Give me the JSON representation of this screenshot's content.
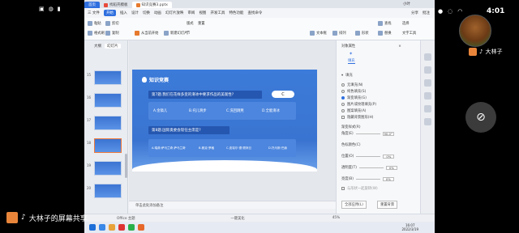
{
  "status_bar_left": {
    "icons": [
      "photo-icon",
      "wechat-icon",
      "signal-icon"
    ]
  },
  "status_bar_right": {
    "clock": "4:01"
  },
  "titlebar": {
    "tabs": [
      {
        "label": "首页",
        "kind": "home"
      },
      {
        "label": "找稻壳模板",
        "kind": "normal"
      },
      {
        "label": "知识竞赛3.pptx",
        "kind": "active"
      }
    ],
    "user": "小叶"
  },
  "menubar": {
    "items": [
      "三 文件",
      "开始",
      "插入",
      "设计",
      "切换",
      "动画",
      "幻灯片放映",
      "审阅",
      "视图",
      "开发工具",
      "特色功能",
      "查找命令"
    ],
    "right": [
      "分享",
      "批注"
    ]
  },
  "ribbon": {
    "labels": [
      "粘贴",
      "格式刷",
      "剪切",
      "复制",
      "从当前开始",
      "新建幻灯片",
      "版式",
      "节",
      "重置",
      "文本框",
      "排列",
      "形状",
      "查找",
      "替换",
      "文字工具",
      "选择"
    ]
  },
  "left_pane": {
    "tabs": [
      "大纲",
      "幻灯片"
    ],
    "slide_numbers": [
      "15",
      "16",
      "17",
      "18",
      "19",
      "20"
    ],
    "selected": "18"
  },
  "slide": {
    "title": "知识竞赛",
    "q7": "第7题.我们在花样多变的滑冰中要求作品的美观性?",
    "q7_answer": "C",
    "q7_options": [
      "A.金镐儿",
      "B.托儿滑步",
      "C.洗回跳凳",
      "D.全能滑冰"
    ],
    "q8": "第8题.国际奥委会现任主席是?",
    "q8_options": [
      "A.瑞典·萨马兰奇 萨马兰奇",
      "B.雅克·罗格",
      "C.皮埃尔·德·顾拜旦",
      "D.托马斯·巴赫"
    ]
  },
  "notes_bar": {
    "text": "单击此处添加备注"
  },
  "right_pane": {
    "title": "对象属性",
    "section_label": "填充",
    "fill_options": [
      "无填充(N)",
      "纯色填充(S)",
      "渐变填充(G)",
      "图片或纹理填充(P)",
      "图案填充(A)"
    ],
    "checkbox": "隐藏背景图形(H)",
    "gradient_style": "渐变样式(R)",
    "angle_label": "角度(E)",
    "angle_value": "90.0°",
    "stops_label": "色标颜色(C)",
    "position_label": "位置(O)",
    "position_value": "0%",
    "transparency_label": "透明度(T)",
    "transparency_value": "0%",
    "brightness_label": "亮度(B)",
    "brightness_value": "0%",
    "rotate_label": "与形状一起旋转(W)",
    "apply_all": "全部应用(L)",
    "reset_bg": "重置背景"
  },
  "statusbar": {
    "office_theme": "Office 主题",
    "layout": "一键美化",
    "zoom": "45%"
  },
  "taskbar": {
    "time": "16:07",
    "date": "2022/3/19"
  },
  "overlay": {
    "host_name": "大林子",
    "sharer": "大林子的屏幕共享"
  },
  "colors": {
    "accent": "#2f6fdf",
    "slide_bg": "#3a74d1"
  }
}
